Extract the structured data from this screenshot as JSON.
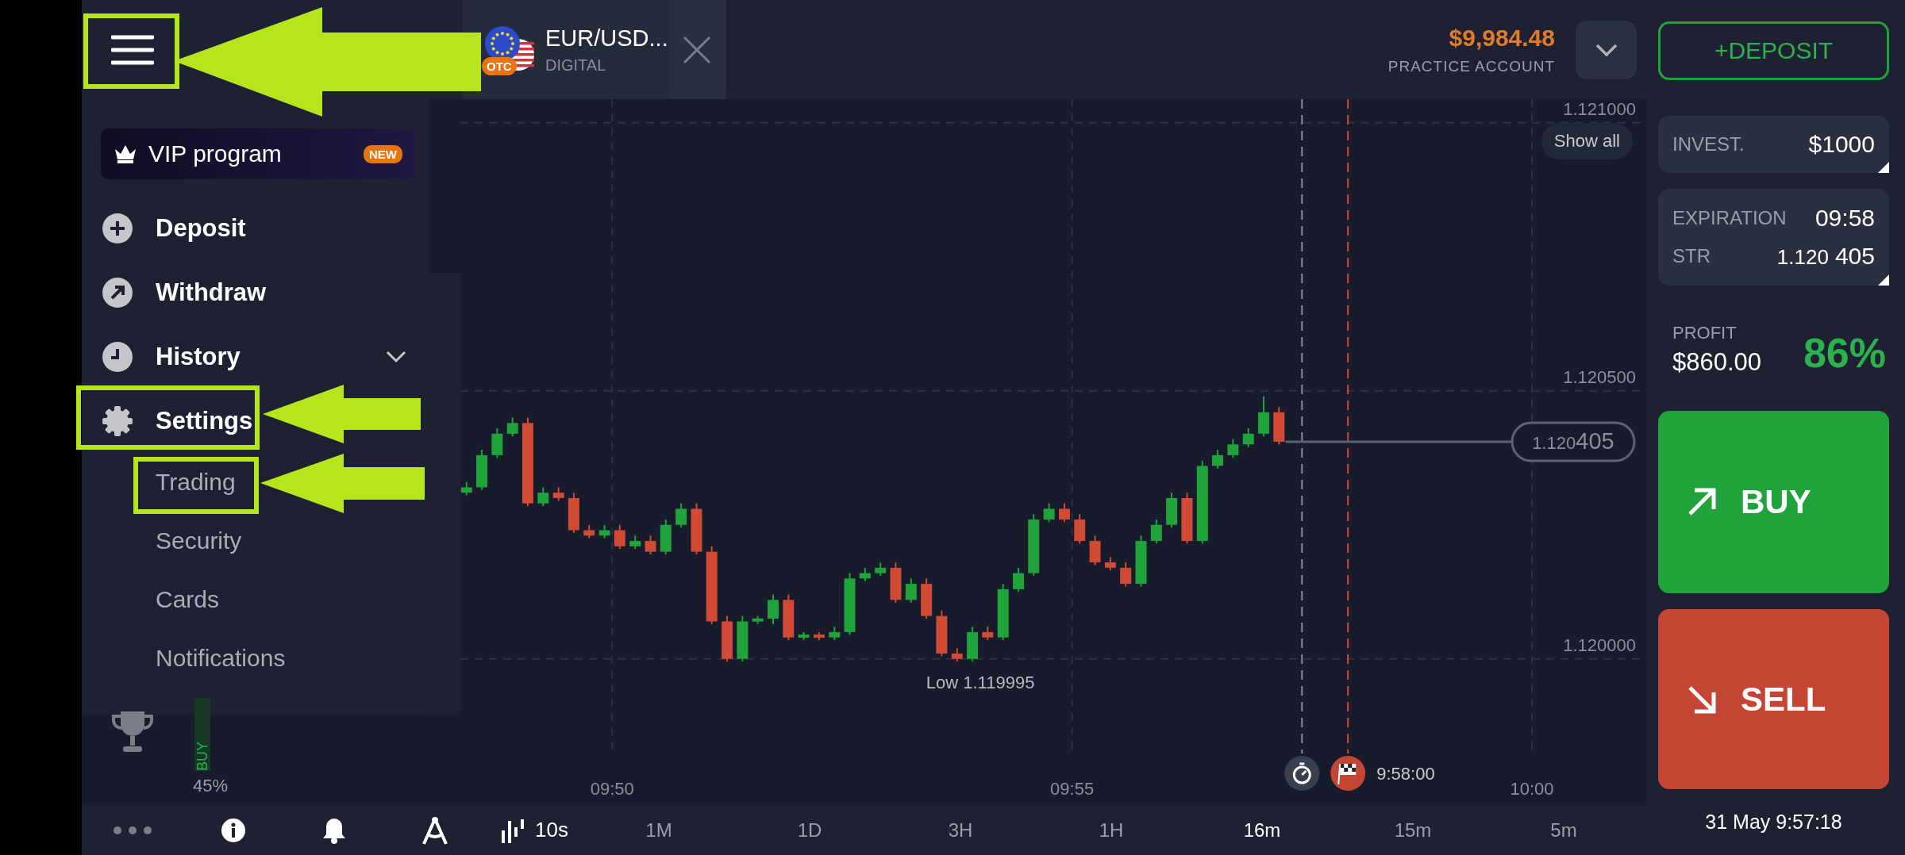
{
  "top_bar": {
    "tab": {
      "symbol": "EUR/USD...",
      "type": "DIGITAL",
      "badge": "OTC"
    },
    "balance": {
      "amount": "$9,984.48",
      "account": "PRACTICE ACCOUNT"
    }
  },
  "side_menu": {
    "vip": {
      "label": "VIP program",
      "badge": "NEW"
    },
    "items": [
      {
        "label": "Deposit",
        "collapsed": false
      },
      {
        "label": "Withdraw",
        "collapsed": false
      },
      {
        "label": "History",
        "collapsed": true
      },
      {
        "label": "Settings",
        "collapsed": false,
        "children": [
          {
            "label": "Trading"
          },
          {
            "label": "Security"
          },
          {
            "label": "Cards"
          },
          {
            "label": "Notifications"
          }
        ]
      }
    ]
  },
  "chart": {
    "show_all": "Show all",
    "expiration_time": "9:58:00",
    "current_price": {
      "head": "1.120",
      "tail": "405"
    },
    "chart_data": {
      "type": "candlestick",
      "grid": true,
      "xlim": [
        588.35,
        600
      ],
      "ylim": [
        1.119831,
        1.121044
      ],
      "x": [
        588.417,
        588.583,
        588.75,
        588.917,
        589.083,
        589.25,
        589.417,
        589.583,
        589.75,
        589.917,
        590.083,
        590.25,
        590.417,
        590.583,
        590.75,
        590.917,
        591.083,
        591.25,
        591.417,
        591.583,
        591.75,
        591.917,
        592.083,
        592.25,
        592.417,
        592.583,
        592.75,
        592.917,
        593.083,
        593.25,
        593.417,
        593.583,
        593.75,
        593.917,
        594.083,
        594.25,
        594.417,
        594.583,
        594.75,
        594.917,
        595.083,
        595.25,
        595.417,
        595.583,
        595.75,
        595.917,
        596.083,
        596.25,
        596.417,
        596.583,
        596.75,
        596.917,
        597.083,
        597.25
      ],
      "ohlc": [
        [
          1.12031,
          1.12033,
          1.120305,
          1.12032
        ],
        [
          1.12032,
          1.12039,
          1.120315,
          1.12038
        ],
        [
          1.12038,
          1.12043,
          1.120375,
          1.12042
        ],
        [
          1.12042,
          1.12045,
          1.120415,
          1.12044
        ],
        [
          1.12044,
          1.12045,
          1.120285,
          1.12029
        ],
        [
          1.12029,
          1.12032,
          1.120285,
          1.12031
        ],
        [
          1.12031,
          1.12032,
          1.120295,
          1.1203
        ],
        [
          1.1203,
          1.12031,
          1.120235,
          1.12024
        ],
        [
          1.12024,
          1.12025,
          1.120225,
          1.12023
        ],
        [
          1.12023,
          1.12025,
          1.120225,
          1.12024
        ],
        [
          1.12024,
          1.12025,
          1.120205,
          1.12021
        ],
        [
          1.12021,
          1.12023,
          1.120205,
          1.12022
        ],
        [
          1.12022,
          1.12023,
          1.120195,
          1.1202
        ],
        [
          1.1202,
          1.12026,
          1.120195,
          1.12025
        ],
        [
          1.12025,
          1.12029,
          1.120245,
          1.12028
        ],
        [
          1.12028,
          1.12029,
          1.120195,
          1.1202
        ],
        [
          1.1202,
          1.12021,
          1.120065,
          1.12007
        ],
        [
          1.12007,
          1.12008,
          1.119995,
          1.12
        ],
        [
          1.12,
          1.12008,
          1.119995,
          1.12007
        ],
        [
          1.12007,
          1.12008,
          1.120065,
          1.120075
        ],
        [
          1.120075,
          1.12012,
          1.120065,
          1.12011
        ],
        [
          1.12011,
          1.12012,
          1.120035,
          1.12004
        ],
        [
          1.12004,
          1.12005,
          1.120035,
          1.120045
        ],
        [
          1.120045,
          1.12005,
          1.120035,
          1.12004
        ],
        [
          1.12004,
          1.12006,
          1.120035,
          1.12005
        ],
        [
          1.12005,
          1.12016,
          1.120045,
          1.12015
        ],
        [
          1.12015,
          1.12017,
          1.120145,
          1.12016
        ],
        [
          1.12016,
          1.12018,
          1.120155,
          1.12017
        ],
        [
          1.12017,
          1.12018,
          1.120105,
          1.12011
        ],
        [
          1.12011,
          1.12015,
          1.120105,
          1.12014
        ],
        [
          1.12014,
          1.12015,
          1.120075,
          1.12008
        ],
        [
          1.12008,
          1.12009,
          1.120005,
          1.12001
        ],
        [
          1.12001,
          1.12002,
          1.119995,
          1.12
        ],
        [
          1.12,
          1.12006,
          1.119995,
          1.12005
        ],
        [
          1.12005,
          1.12006,
          1.120035,
          1.12004
        ],
        [
          1.12004,
          1.12014,
          1.120035,
          1.12013
        ],
        [
          1.12013,
          1.12017,
          1.120125,
          1.12016
        ],
        [
          1.12016,
          1.12027,
          1.120155,
          1.12026
        ],
        [
          1.12026,
          1.12029,
          1.120255,
          1.12028
        ],
        [
          1.12028,
          1.12029,
          1.120255,
          1.12026
        ],
        [
          1.12026,
          1.12027,
          1.120215,
          1.12022
        ],
        [
          1.12022,
          1.12023,
          1.120175,
          1.12018
        ],
        [
          1.12018,
          1.12019,
          1.120165,
          1.12017
        ],
        [
          1.12017,
          1.12018,
          1.120135,
          1.12014
        ],
        [
          1.12014,
          1.12023,
          1.120135,
          1.12022
        ],
        [
          1.12022,
          1.12026,
          1.120215,
          1.12025
        ],
        [
          1.12025,
          1.12031,
          1.120245,
          1.1203
        ],
        [
          1.1203,
          1.12031,
          1.120215,
          1.12022
        ],
        [
          1.12022,
          1.12037,
          1.120215,
          1.12036
        ],
        [
          1.12036,
          1.12039,
          1.120355,
          1.12038
        ],
        [
          1.12038,
          1.12041,
          1.120375,
          1.1204
        ],
        [
          1.1204,
          1.12043,
          1.120395,
          1.12042
        ],
        [
          1.12042,
          1.12049,
          1.120415,
          1.12046
        ],
        [
          1.12046,
          1.12047,
          1.1204,
          1.120405
        ]
      ],
      "yticks": [
        {
          "value": 1.121,
          "label": "1.121000"
        },
        {
          "value": 1.1205,
          "label": "1.120500"
        },
        {
          "value": 1.12,
          "label": "1.120000"
        }
      ],
      "xticks": [
        {
          "value": 590,
          "label": "09:50"
        },
        {
          "value": 595,
          "label": "09:55"
        },
        {
          "value": 600,
          "label": "10:00"
        }
      ],
      "ref_lines": [
        {
          "axis": "x",
          "value": 597.5,
          "color": "#8a8e9a"
        },
        {
          "axis": "x",
          "value": 598,
          "color": "#d04a35"
        }
      ],
      "annotations": [
        "Low 1.119995"
      ]
    }
  },
  "sentiment": {
    "label": "BUY",
    "value": "45%"
  },
  "toolbar": {
    "interval": "10s",
    "time_ranges": [
      {
        "label": "1M",
        "selected": false
      },
      {
        "label": "1D",
        "selected": false
      },
      {
        "label": "3H",
        "selected": false
      },
      {
        "label": "1H",
        "selected": false
      },
      {
        "label": "16m",
        "selected": true
      },
      {
        "label": "15m",
        "selected": false
      },
      {
        "label": "5m",
        "selected": false
      }
    ]
  },
  "trade_panel": {
    "deposit_button": "+DEPOSIT",
    "invest": {
      "label": "INVEST.",
      "value": "$1000"
    },
    "expiration": {
      "label": "EXPIRATION",
      "value": "09:58"
    },
    "strike": {
      "label": "STR",
      "head": "1.120",
      "tail": "405"
    },
    "profit": {
      "label": "PROFIT",
      "amount": "$860.00",
      "percent": "86%"
    },
    "buy": "BUY",
    "sell": "SELL",
    "datetime": "31 May 9:57:18"
  }
}
